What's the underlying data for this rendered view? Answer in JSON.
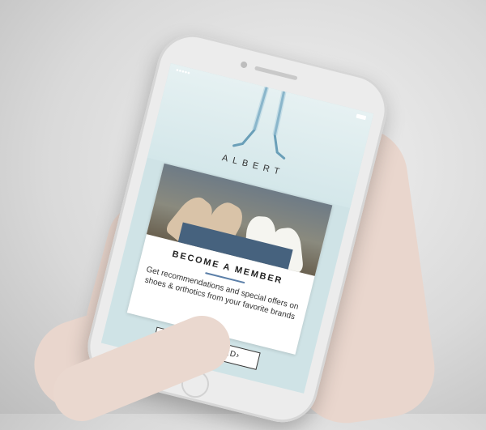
{
  "app": {
    "brand": "ALBERT",
    "card": {
      "title": "BECOME A MEMBER",
      "body": "Get recommendations and special offers on shoes & orthotics from your favorite brands"
    },
    "pagination": {
      "count": 3,
      "active": 3
    },
    "cta_label": "GET STARTED›"
  },
  "colors": {
    "screen_background": "#cfe3e6",
    "divider": "#5b7fa8"
  },
  "icons": [
    "signal-icon",
    "wifi-icon",
    "battery-icon"
  ]
}
